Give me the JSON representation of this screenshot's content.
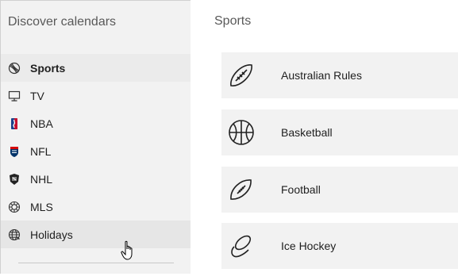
{
  "sidebar": {
    "title": "Discover calendars",
    "items": [
      {
        "label": "Sports",
        "icon": "sports-ball-icon"
      },
      {
        "label": "TV",
        "icon": "tv-monitor-icon"
      },
      {
        "label": "NBA",
        "icon": "nba-logo-icon"
      },
      {
        "label": "NFL",
        "icon": "nfl-logo-icon"
      },
      {
        "label": "NHL",
        "icon": "nhl-logo-icon"
      },
      {
        "label": "MLS",
        "icon": "mls-logo-icon"
      },
      {
        "label": "Holidays",
        "icon": "globe-icon"
      }
    ]
  },
  "main": {
    "title": "Sports",
    "cards": [
      {
        "label": "Australian Rules",
        "icon": "australian-rules-ball-icon"
      },
      {
        "label": "Basketball",
        "icon": "basketball-icon"
      },
      {
        "label": "Football",
        "icon": "football-icon"
      },
      {
        "label": "Ice Hockey",
        "icon": "hockey-puck-icon"
      }
    ]
  }
}
